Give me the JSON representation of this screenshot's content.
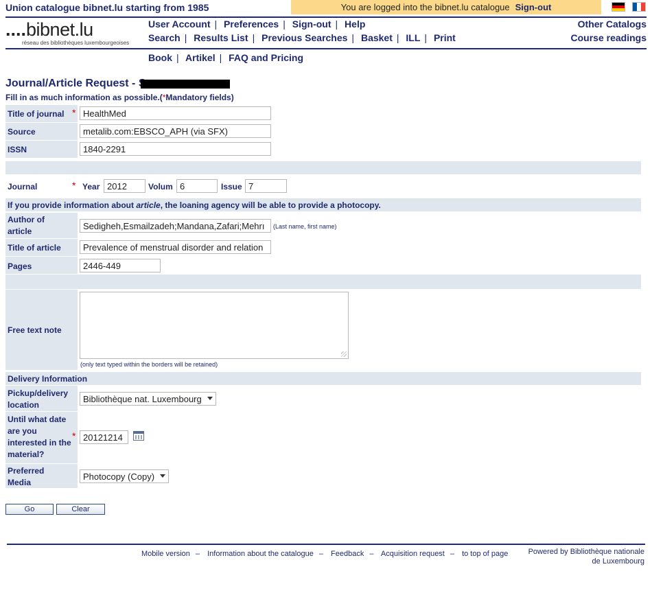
{
  "header": {
    "site_title": "Union catalogue bibnet.lu starting from 1985",
    "login_text": "You are logged into the bibnet.lu catalogue",
    "login_signout": "Sign-out",
    "logo_dots": "....",
    "logo_name": "bibnet.lu",
    "logo_tagline": "réseau des bibliothèques luxembourgeoises"
  },
  "nav": {
    "row1": [
      "User Account",
      "Preferences",
      "Sign-out",
      "Help"
    ],
    "row2": [
      "Search",
      "Results List",
      "Previous Searches",
      "Basket",
      "ILL",
      "Print"
    ],
    "row3": [
      "Book",
      "Artikel",
      "FAQ and Pricing"
    ],
    "right": [
      "Other Catalogs",
      "Course readings"
    ],
    "separator": "|"
  },
  "page": {
    "title": "Journal/Article Request - S",
    "instructions_pre": "Fill in as much information as possible.(",
    "instructions_star": "*",
    "instructions_post": "Mandatory fields)",
    "required_mark": "*"
  },
  "form": {
    "title_of_journal": {
      "label": "Title of journal",
      "value": "HealthMed"
    },
    "source": {
      "label": "Source",
      "value": "metalib.com:EBSCO_APH (via SFX)"
    },
    "issn": {
      "label": "ISSN",
      "value": "1840-2291"
    },
    "journal": {
      "label": "Journal",
      "year_label": "Year",
      "year_value": "2012",
      "volume_label": "Volum",
      "volume_value": "6",
      "issue_label": "Issue",
      "issue_value": "7"
    },
    "article_notice_pre": "If you provide information about ",
    "article_notice_em": "article",
    "article_notice_post": ", the loaning agency will be able to provide a photocopy.",
    "author": {
      "label": "Author of article",
      "value": "Sedigheh,Esmailzadeh;Mandana,Zafari;Mehrı",
      "hint": "(Last name, first name)"
    },
    "article_title": {
      "label": "Title of article",
      "value": "Prevalence of menstrual disorder and relation"
    },
    "pages": {
      "label": "Pages",
      "value": "2446-449"
    },
    "free_text": {
      "label": "Free text note",
      "value": "",
      "hint": "(only text typed within the borders will be retained)"
    },
    "delivery_header": "Delivery Information",
    "pickup": {
      "label": "Pickup/delivery location",
      "value": "Bibliothèque nat. Luxembourg"
    },
    "until_date": {
      "label": "Until what date are you interested in the material?",
      "value": "20121214"
    },
    "media": {
      "label": "Preferred Media",
      "value": "Photocopy (Copy)"
    }
  },
  "buttons": {
    "go": "Go",
    "clear": "Clear"
  },
  "footer": {
    "links": [
      "Mobile version",
      "Information about the catalogue",
      "Feedback",
      "Acquisition request",
      "to top of page"
    ],
    "dash": "–",
    "powered_line1": "Powered by Bibliothèque nationale",
    "powered_line2": "de Luxembourg"
  },
  "colors": {
    "accent": "#1f2a6e",
    "login_bar": "#fcd98a",
    "row_bg": "#dfe6ee",
    "required": "#cc0000"
  }
}
